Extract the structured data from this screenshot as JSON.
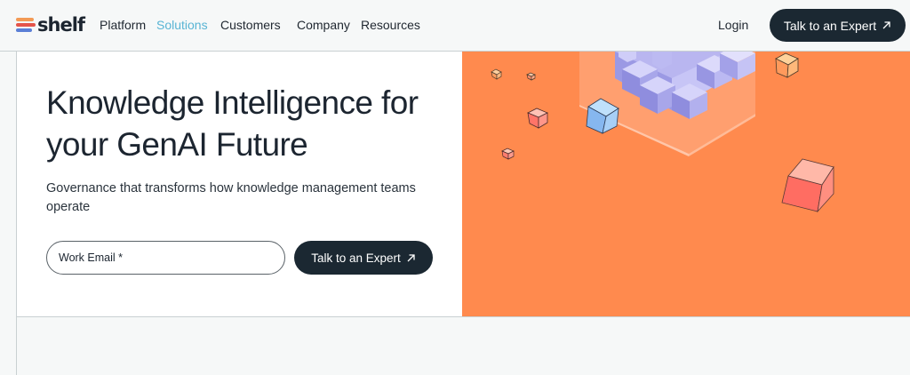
{
  "brand": {
    "name": "shelf"
  },
  "nav": {
    "items": [
      {
        "label": "Platform",
        "active": false
      },
      {
        "label": "Solutions",
        "active": true
      },
      {
        "label": "Customers",
        "active": false
      },
      {
        "label": "Company",
        "active": false
      },
      {
        "label": "Resources",
        "active": false
      }
    ],
    "login": "Login",
    "cta": "Talk to an Expert"
  },
  "hero": {
    "headline_line1": "Knowledge Intelligence for",
    "headline_line2": "your GenAI Future",
    "subtext": "Governance that transforms how knowledge management teams operate",
    "email_placeholder": "Work Email *",
    "cta": "Talk to an Expert"
  },
  "colors": {
    "accent_orange": "#ff8a4e",
    "dark_button": "#1b2832",
    "active_nav": "#58b4d4"
  },
  "icons": {
    "arrow": "arrow-up-right-icon"
  }
}
